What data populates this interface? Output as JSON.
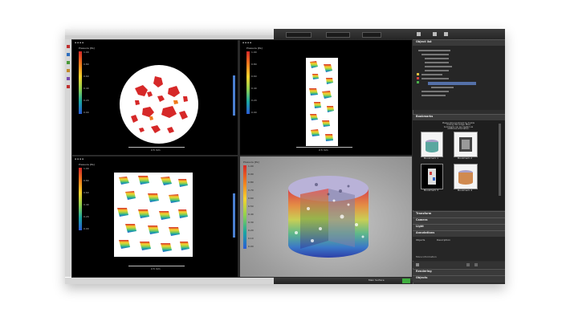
{
  "viewports": {
    "top_left": {
      "caption": "Pressure [Pa]",
      "ticks": [
        "1.00",
        "0.80",
        "0.60",
        "0.40",
        "0.20",
        "0.00"
      ]
    },
    "top_right": {
      "caption": "Pressure [Pa]",
      "ticks": [
        "1.00",
        "0.80",
        "0.60",
        "0.40",
        "0.20",
        "0.00"
      ]
    },
    "bottom_left": {
      "caption": "Pressure [Pa]",
      "ticks": [
        "1.00",
        "0.80",
        "0.60",
        "0.40",
        "0.20",
        "0.00"
      ]
    },
    "bottom_right": {
      "caption": "Pressure [Pa]",
      "ticks": [
        "1.00",
        "0.90",
        "0.80",
        "0.70",
        "0.60",
        "0.50",
        "0.40",
        "0.30",
        "0.20",
        "0.10",
        "0.00"
      ]
    },
    "scale_label": "2.5 mm"
  },
  "panels": {
    "object_list": "Object list",
    "bookmarks": "Bookmarks",
    "bookmark_hint": "Please store bookmark by double clicking this image. More bookmarks can be created via additional information.",
    "bookmark_items": [
      "Bookmark 1",
      "Bookmark 2",
      "Bookmark 3",
      "Bookmark 4"
    ],
    "collapsed": [
      "Transform",
      "Camera",
      "Light",
      "Annotations"
    ],
    "annotation_columns": [
      "Objects",
      "Description"
    ],
    "more_info": "More information",
    "bottom_panels": [
      "Rendering",
      "Objects"
    ]
  },
  "status_bar": {
    "right_label": "Main Surface"
  },
  "colorbar": [
    "#d62828",
    "#f07b1d",
    "#f6d32d",
    "#8fd14f",
    "#1aa7a1",
    "#2a5bd7"
  ]
}
